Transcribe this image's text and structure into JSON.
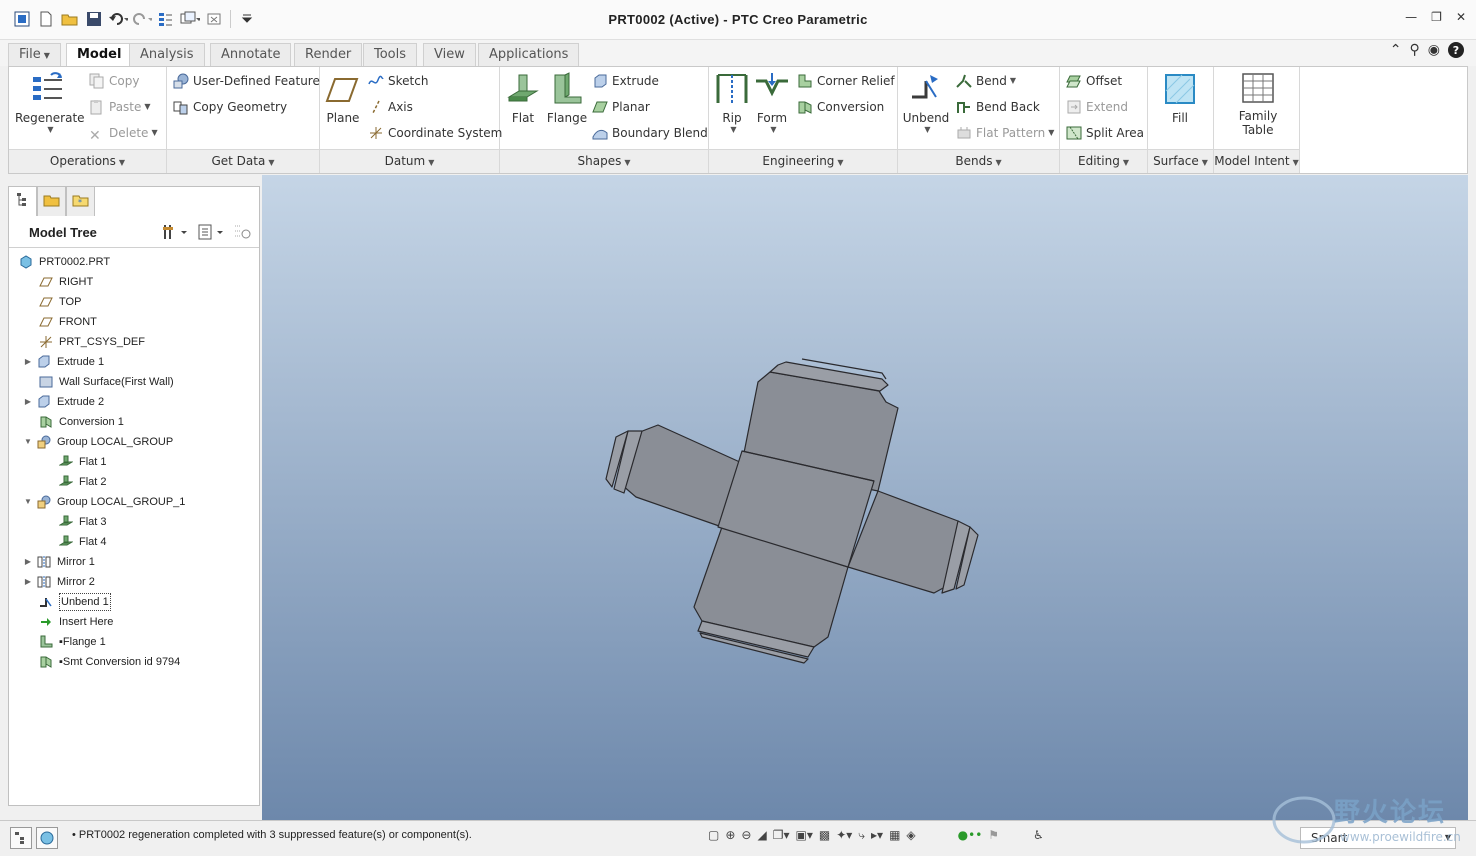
{
  "window": {
    "title": "PRT0002 (Active) - PTC Creo Parametric"
  },
  "quick_access": [
    "window-icon",
    "new-icon",
    "open-icon",
    "save-icon",
    "undo-icon",
    "redo-icon",
    "regenerate-icon",
    "windows-icon",
    "close-icon",
    "customize-icon"
  ],
  "tabs": [
    {
      "label": "File"
    },
    {
      "label": "Model"
    },
    {
      "label": "Analysis"
    },
    {
      "label": "Annotate"
    },
    {
      "label": "Render"
    },
    {
      "label": "Tools"
    },
    {
      "label": "View"
    },
    {
      "label": "Applications"
    }
  ],
  "ribbon": {
    "operations": {
      "footer": "Operations",
      "regenerate": "Regenerate",
      "copy": "Copy",
      "paste": "Paste",
      "delete": "Delete"
    },
    "get_data": {
      "footer": "Get Data",
      "udf": "User-Defined Feature",
      "copy_geometry": "Copy Geometry"
    },
    "datum": {
      "footer": "Datum",
      "plane": "Plane",
      "sketch": "Sketch",
      "axis": "Axis",
      "csys": "Coordinate System"
    },
    "shapes": {
      "footer": "Shapes",
      "flat": "Flat",
      "flange": "Flange",
      "extrude": "Extrude",
      "planar": "Planar",
      "boundary_blend": "Boundary Blend"
    },
    "engineering": {
      "footer": "Engineering",
      "rip": "Rip",
      "form": "Form",
      "corner_relief": "Corner Relief",
      "conversion": "Conversion"
    },
    "bends": {
      "footer": "Bends",
      "unbend": "Unbend",
      "bend": "Bend",
      "bend_back": "Bend Back",
      "flat_pattern": "Flat Pattern"
    },
    "editing": {
      "footer": "Editing",
      "offset": "Offset",
      "extend": "Extend",
      "split_area": "Split Area"
    },
    "surface": {
      "footer": "Surface",
      "fill": "Fill"
    },
    "model_intent": {
      "footer": "Model Intent",
      "family_table_1": "Family",
      "family_table_2": "Table"
    }
  },
  "model_tree": {
    "title": "Model Tree",
    "items": [
      {
        "label": "PRT0002.PRT"
      },
      {
        "label": "RIGHT"
      },
      {
        "label": "TOP"
      },
      {
        "label": "FRONT"
      },
      {
        "label": "PRT_CSYS_DEF"
      },
      {
        "label": "Extrude 1"
      },
      {
        "label": "Wall Surface(First Wall)"
      },
      {
        "label": "Extrude 2"
      },
      {
        "label": "Conversion 1"
      },
      {
        "label": "Group LOCAL_GROUP"
      },
      {
        "label": "Flat 1"
      },
      {
        "label": "Flat 2"
      },
      {
        "label": "Group LOCAL_GROUP_1"
      },
      {
        "label": "Flat 3"
      },
      {
        "label": "Flat 4"
      },
      {
        "label": "Mirror 1"
      },
      {
        "label": "Mirror 2"
      },
      {
        "label": "Unbend 1"
      },
      {
        "label": "Insert Here"
      },
      {
        "label": "▪Flange 1"
      },
      {
        "label": "▪Smt Conversion id 9794"
      }
    ]
  },
  "status": {
    "message": "• PRT0002 regeneration completed with 3 suppressed feature(s) or component(s).",
    "filter": "Smart"
  },
  "watermark": {
    "text": "野火论坛",
    "url": "www.proewildfire.cn"
  },
  "colors": {
    "viewport_top": "#c5d5e6",
    "viewport_bottom": "#6d88ab",
    "part_fill": "#8a8e96",
    "accent": "#2a6cc4"
  }
}
